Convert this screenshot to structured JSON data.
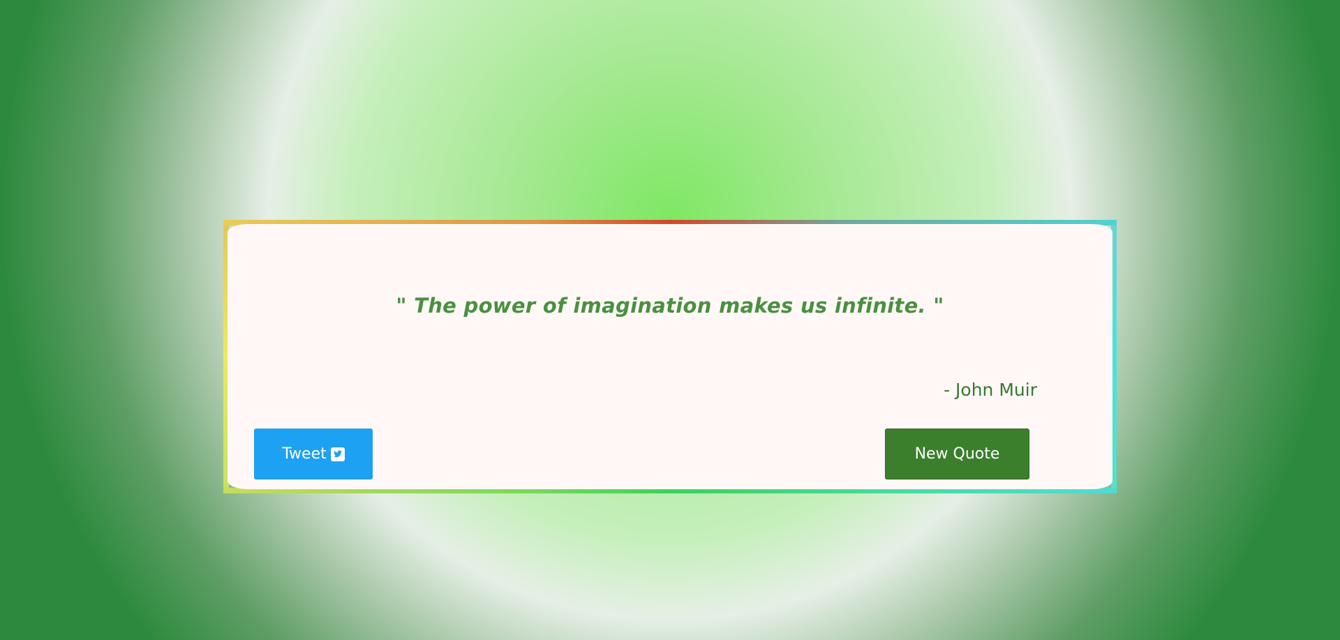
{
  "quote": {
    "text": "\" The power of imagination makes us infinite. \"",
    "author": "- John Muir"
  },
  "buttons": {
    "tweet_label": "Tweet",
    "tweet_icon": "twitter-square-icon",
    "new_quote_label": "New Quote"
  },
  "colors": {
    "quote_text": "#4a9040",
    "author_text": "#367a2e",
    "tweet_button": "#1da1f2",
    "new_quote_button": "#3b7f2c",
    "card_background": "#fff8f7"
  }
}
